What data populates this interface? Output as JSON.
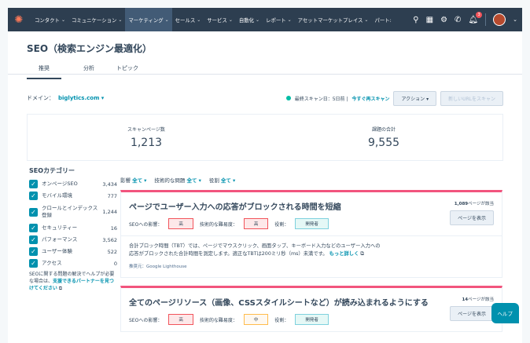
{
  "topnav": {
    "items": [
      "コンタクト",
      "コミュニケーション",
      "マーケティング",
      "セールス",
      "サービス",
      "自動化",
      "レポート",
      "アセットマーケットプレイス",
      "パート:"
    ],
    "notification_count": "3"
  },
  "page": {
    "title": "SEO（検索エンジン最適化）",
    "tabs": [
      "推奨",
      "分析",
      "トピック"
    ]
  },
  "domain": {
    "label": "ドメイン：",
    "value": "biglytics.com",
    "scan_text": "最終スキャン日：5日前 |",
    "rescan_link": "今すぐ再スキャン",
    "action_button": "アクション",
    "new_scan_button": "新しいURLをスキャン"
  },
  "stats": {
    "scanned_label": "スキャンページ数",
    "scanned_value": "1,213",
    "issues_label": "課題の合計",
    "issues_value": "9,555"
  },
  "sidebar": {
    "title": "SEOカテゴリー",
    "categories": [
      {
        "name": "オンページSEO",
        "count": "3,434"
      },
      {
        "name": "モバイル環境",
        "count": "777"
      },
      {
        "name": "クロールとインデックス登録",
        "count": "1,244"
      },
      {
        "name": "セキュリティー",
        "count": "16"
      },
      {
        "name": "パフォーマンス",
        "count": "3,562"
      },
      {
        "name": "ユーザー体験",
        "count": "522"
      },
      {
        "name": "アクセス",
        "count": "0"
      }
    ],
    "help_text": "SEOに関する問題の解決でヘルプが必要な場合は、",
    "help_link": "支援できるパートナーを見つけてください"
  },
  "filters": {
    "impact_label": "影響",
    "impact_value": "全て",
    "difficulty_label": "技術的な問題",
    "difficulty_value": "全て",
    "role_label": "役割",
    "role_value": "全て"
  },
  "cards": [
    {
      "title": "ページでユーザー入力への応答がブロックされる時間を短縮",
      "impact_label": "SEOへの影響：",
      "impact_value": "高",
      "difficulty_label": "技術的な難易度：",
      "difficulty_value": "高",
      "role_label": "役割：",
      "role_value": "開発者",
      "pages_count": "1,089",
      "pages_suffix": "ページが該当",
      "view_button": "ページを表示",
      "description": "合計ブロック時間（TBT）では、ページでマウスクリック、画面タップ、キーボード入力などのユーザー入力への応答がブロックされた合計時間を測定します。適正なTBTは200ミリ秒（ms）未満です。",
      "more_link": "もっと詳しく",
      "source": "推奨元：Google Lighthouse"
    },
    {
      "title": "全てのページリソース（画像、CSSスタイルシートなど）が読み込まれるようにする",
      "impact_label": "SEOへの影響：",
      "impact_value": "高",
      "difficulty_label": "技術的な難易度：",
      "difficulty_value": "中",
      "role_label": "役割：",
      "role_value": "開発者",
      "pages_count": "14",
      "pages_suffix": "ページが該当",
      "view_button": "ページを表示"
    }
  ],
  "help_button": "ヘルプ"
}
